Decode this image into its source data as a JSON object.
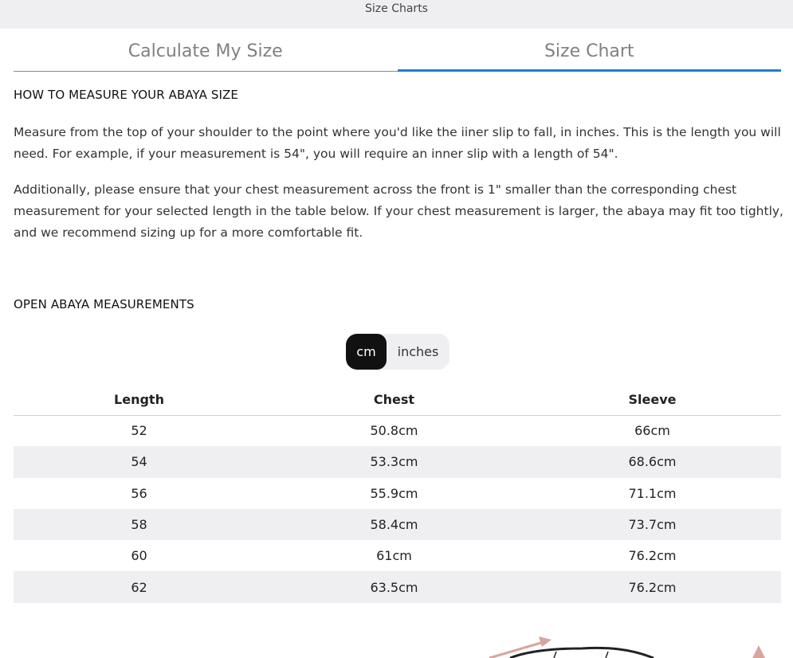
{
  "header": {
    "title": "Size Charts"
  },
  "tabs": [
    {
      "label": "Calculate My Size",
      "active": false
    },
    {
      "label": "Size Chart",
      "active": true
    }
  ],
  "measure": {
    "heading": "HOW TO MEASURE YOUR ABAYA SIZE",
    "paragraph1": "Measure from the top of your shoulder to the point where you'd like the iiner slip to fall, in inches. This is the length you will need. For example, if your measurement is 54\", you will require an inner slip with a length of 54\".",
    "paragraph2": "Additionally, please ensure that your chest measurement across the front is 1\" smaller than the corresponding chest measurement for your selected length in the table below. If your chest measurement is larger, the abaya may fit too tightly, and we recommend sizing up for a more comfortable fit."
  },
  "open_abaya": {
    "heading": "OPEN ABAYA MEASUREMENTS",
    "units": {
      "cm": "cm",
      "inches": "inches",
      "selected": "cm"
    },
    "table": {
      "headers": [
        "Length",
        "Chest",
        "Sleeve"
      ],
      "rows": [
        [
          "52",
          "50.8cm",
          "66cm"
        ],
        [
          "54",
          "53.3cm",
          "68.6cm"
        ],
        [
          "56",
          "55.9cm",
          "71.1cm"
        ],
        [
          "58",
          "58.4cm",
          "73.7cm"
        ],
        [
          "60",
          "61cm",
          "76.2cm"
        ],
        [
          "62",
          "63.5cm",
          "76.2cm"
        ]
      ]
    }
  },
  "colors": {
    "accent": "#1a7ed6",
    "row_alt": "#efeff1",
    "arrow": "#d8a59c"
  }
}
